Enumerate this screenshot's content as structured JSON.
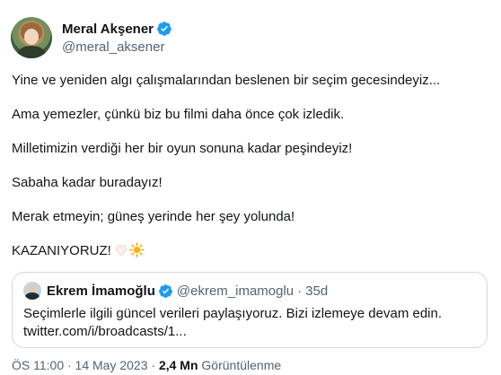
{
  "author": {
    "display_name": "Meral Akşener",
    "handle": "@meral_aksener",
    "verified_icon": "verified-badge-icon"
  },
  "tweet": {
    "lines": [
      "Yine ve yeniden algı çalışmalarından beslenen bir seçim gecesindeyiz...",
      "Ama yemezler, çünkü biz bu filmi daha önce çok izledik.",
      "Milletimizin verdiği her bir oyun sonuna kadar peşindeyiz!",
      "Sabaha kadar buradayız!",
      "Merak etmeyin; güneş yerinde her şey yolunda!",
      "KAZANIYORUZ!"
    ],
    "emojis": [
      "white-heart-icon",
      "sun-icon"
    ]
  },
  "quote": {
    "display_name": "Ekrem İmamoğlu",
    "handle": "@ekrem_imamoglu",
    "separator": "·",
    "time": "35d",
    "text_line1": "Seçimlerle ilgili güncel verileri paylaşıyoruz. Bizi izlemeye devam edin.",
    "text_line2": "twitter.com/i/broadcasts/1..."
  },
  "meta": {
    "timestamp": "ÖS 11:00 · 14 May 2023 · ",
    "views_count": "2,4 Mn",
    "views_label": " Görüntülenme"
  },
  "colors": {
    "text": "#0f1419",
    "secondary": "#536471",
    "verified": "#1d9bf0",
    "border": "#cfd9de"
  }
}
